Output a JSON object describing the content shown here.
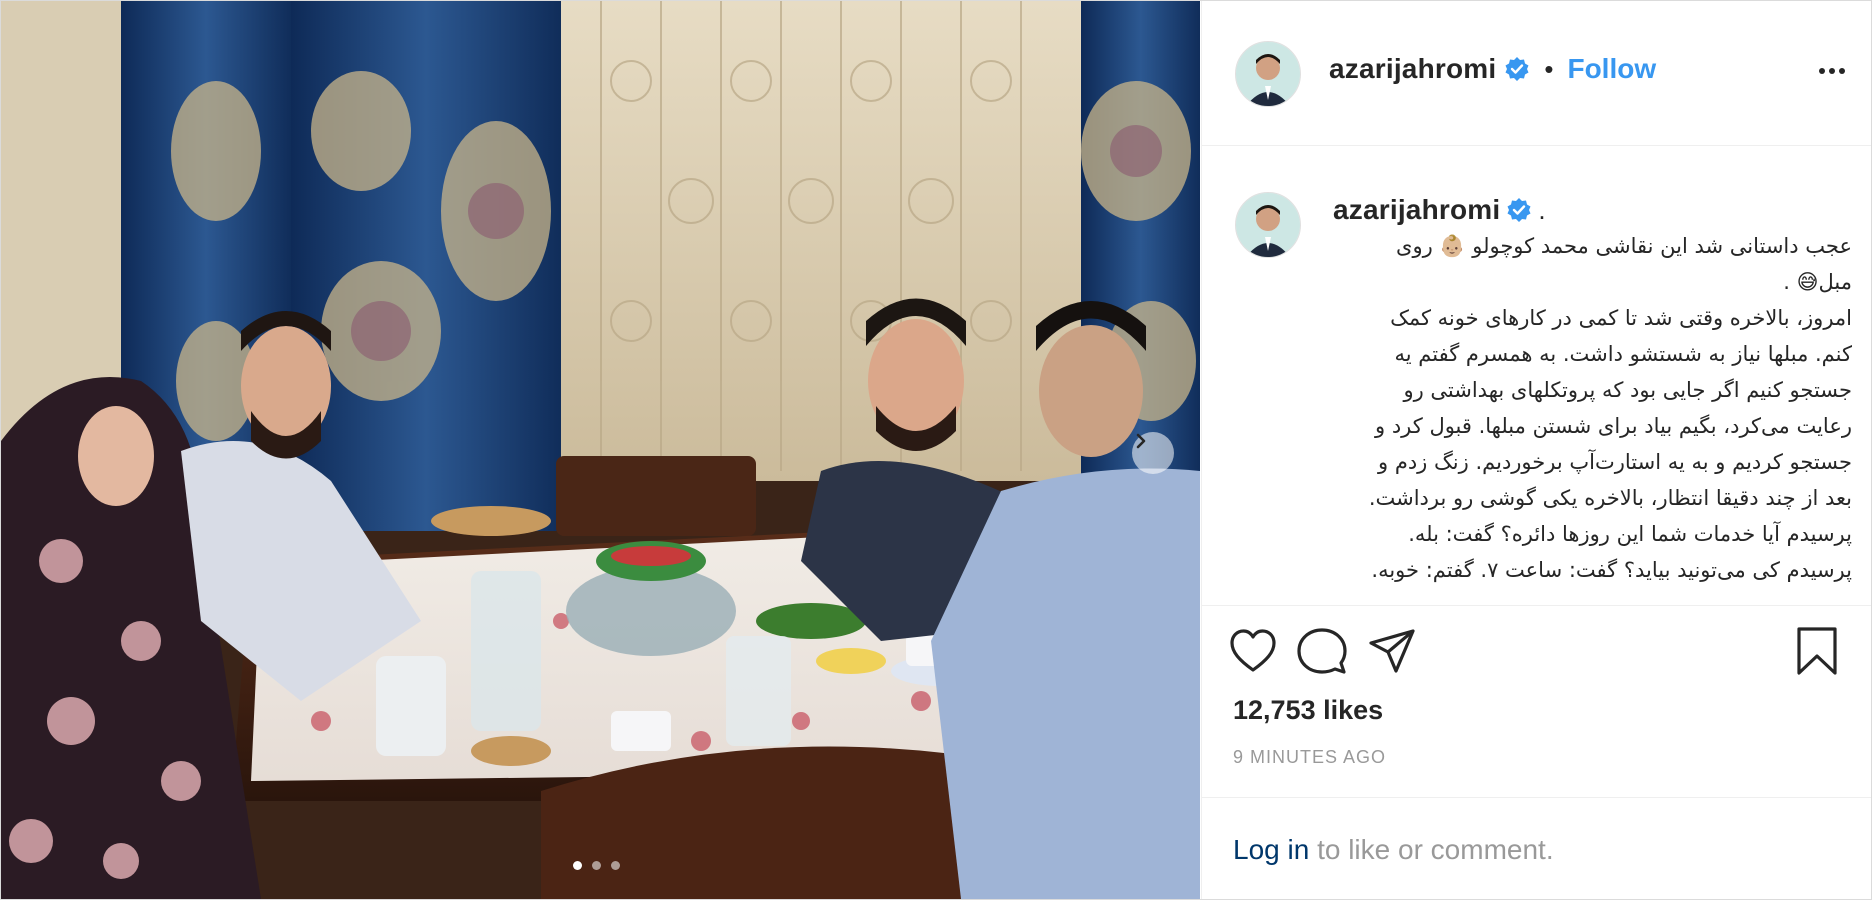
{
  "post": {
    "username": "azarijahromi",
    "follow_label": "Follow",
    "separator": "•",
    "caption_separator": ".",
    "caption_lines": [
      "عجب داستانی شد این نقاشی محمد کوچولو 👶🏼 روی",
      "مبل😅 .",
      "امروز، بالاخره وقتی شد تا کمی در کارهای خونه کمک",
      "کنم. مبلها نیاز به شستشو داشت. به همسرم گفتم یه",
      "جستجو کنیم اگر جایی بود که پروتکلهای بهداشتی رو",
      "رعایت می‌کرد، بگیم بیاد برای شستن مبلها. قبول کرد و",
      "جستجو کردیم و به یه استارت‌آپ برخوردیم. زنگ زدم و",
      "بعد از چند دقیقا انتظار، بالاخره یکی گوشی رو برداشت.",
      "پرسیدم آیا خدمات شما این روزها دائره؟ گفت: بله.",
      "پرسیدم کی می‌تونید بیاید؟ گفت: ساعت ۷. گفتم: خوبه."
    ],
    "likes": "12,753 likes",
    "timestamp": "9 MINUTES AGO",
    "login_link": "Log in",
    "login_rest": " to like or comment."
  },
  "carousel": {
    "slide_count": 3,
    "active_index": 0
  },
  "icons": {
    "verified": "verified-badge-icon",
    "more": "more-options-icon",
    "like": "heart-icon",
    "comment": "comment-icon",
    "share": "share-icon",
    "save": "bookmark-icon",
    "next": "chevron-right-icon"
  },
  "colors": {
    "link_blue": "#3897f0",
    "text": "#262626",
    "muted": "#999999",
    "login_link": "#00376b"
  }
}
